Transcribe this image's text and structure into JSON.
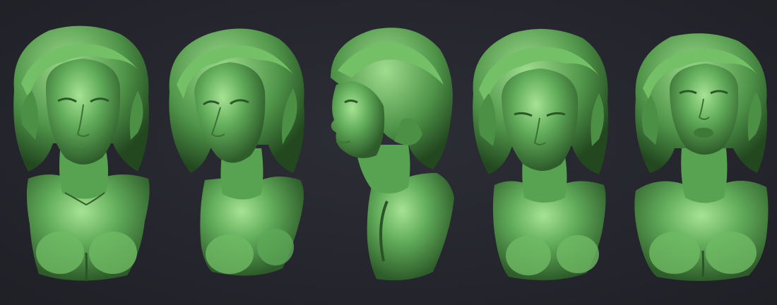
{
  "viewport": {
    "background_color": "#25262d"
  },
  "material": {
    "base_color": "#5fa85a",
    "light_color": "#8fd481",
    "highlight_color": "#b9eda9",
    "shadow_color": "#2f5e2b",
    "deep_shadow_color": "#1d3c1a"
  },
  "busts": [
    {
      "view": "front",
      "icon": "bust-front-icon"
    },
    {
      "view": "three-quarter-left",
      "icon": "bust-three-quarter-icon"
    },
    {
      "view": "profile-left",
      "icon": "bust-profile-icon"
    },
    {
      "view": "front-looking-down",
      "icon": "bust-looking-down-icon"
    },
    {
      "view": "front-looking-up",
      "icon": "bust-looking-up-icon"
    }
  ]
}
